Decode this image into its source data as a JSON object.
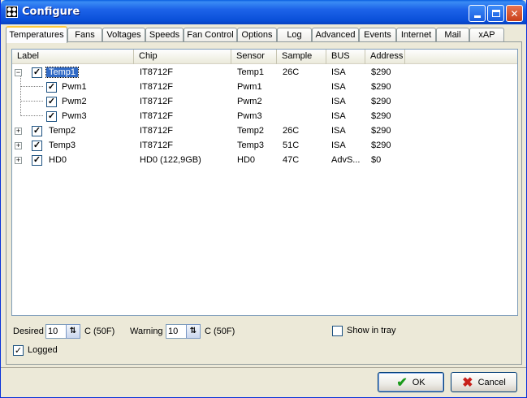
{
  "window": {
    "title": "Configure"
  },
  "tabs": [
    "Temperatures",
    "Fans",
    "Voltages",
    "Speeds",
    "Fan Control",
    "Options",
    "Log",
    "Advanced",
    "Events",
    "Internet",
    "Mail",
    "xAP"
  ],
  "active_tab": "Temperatures",
  "columns": [
    "Label",
    "Chip",
    "Sensor",
    "Sample",
    "BUS",
    "Address"
  ],
  "rows": [
    {
      "label": "Temp1",
      "chip": "IT8712F",
      "sensor": "Temp1",
      "sample": "26C",
      "bus": "ISA",
      "address": "$290",
      "expander": "−",
      "checked": "✓"
    },
    {
      "label": "Pwm1",
      "chip": "IT8712F",
      "sensor": "Pwm1",
      "sample": "",
      "bus": "ISA",
      "address": "$290",
      "expander": "",
      "checked": "✓"
    },
    {
      "label": "Pwm2",
      "chip": "IT8712F",
      "sensor": "Pwm2",
      "sample": "",
      "bus": "ISA",
      "address": "$290",
      "expander": "",
      "checked": "✓"
    },
    {
      "label": "Pwm3",
      "chip": "IT8712F",
      "sensor": "Pwm3",
      "sample": "",
      "bus": "ISA",
      "address": "$290",
      "expander": "",
      "checked": "✓"
    },
    {
      "label": "Temp2",
      "chip": "IT8712F",
      "sensor": "Temp2",
      "sample": "26C",
      "bus": "ISA",
      "address": "$290",
      "expander": "+",
      "checked": "✓"
    },
    {
      "label": "Temp3",
      "chip": "IT8712F",
      "sensor": "Temp3",
      "sample": "51C",
      "bus": "ISA",
      "address": "$290",
      "expander": "+",
      "checked": "✓"
    },
    {
      "label": "HD0",
      "chip": "HD0 (122,9GB)",
      "sensor": "HD0",
      "sample": "47C",
      "bus": "AdvS...",
      "address": "$0",
      "expander": "+",
      "checked": "✓"
    }
  ],
  "controls": {
    "desired_label": "Desired",
    "desired_value": "10",
    "desired_unit": "C (50F)",
    "warning_label": "Warning",
    "warning_value": "10",
    "warning_unit": "C (50F)",
    "show_in_tray_label": "Show in tray",
    "show_in_tray_checked": "",
    "logged_label": "Logged",
    "logged_checked": "✓",
    "spin_glyph": "⇅"
  },
  "buttons": {
    "ok": "OK",
    "cancel": "Cancel",
    "ok_glyph": "✔",
    "cancel_glyph": "✖"
  },
  "titlebar_buttons": {
    "close_glyph": "✕"
  },
  "colors": {
    "selection": "#316ac5",
    "titlebar": "#0a4fd8",
    "ok_icon": "#1a9a1a",
    "cancel_icon": "#c8201a"
  }
}
